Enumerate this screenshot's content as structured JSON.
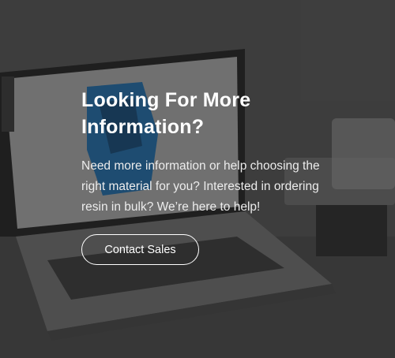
{
  "hero": {
    "title": "Looking For More Information?",
    "description": "Need more information or help choosing the right material for you? Interested in ordering resin in bulk? We’re here to help!",
    "cta_label": "Contact Sales",
    "background_image": "laptop-3d-print-software-photo"
  },
  "colors": {
    "overlay": "#141414",
    "text": "#ffffff",
    "screen_accent": "#2a8bd8"
  }
}
